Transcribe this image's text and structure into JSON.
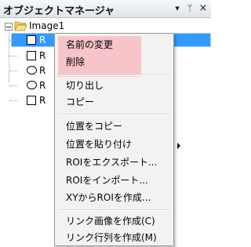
{
  "window": {
    "title": "オブジェクトマネージャ",
    "menu_glyph": "▾",
    "pin_glyph": "ᛘ",
    "close_glyph": "×"
  },
  "tree": {
    "root_label": "Image1",
    "children": [
      {
        "shape": "rectangle",
        "label": "R",
        "selected": true
      },
      {
        "shape": "rectangle",
        "label": "R",
        "selected": false
      },
      {
        "shape": "ellipse",
        "label": "R",
        "selected": false
      },
      {
        "shape": "ellipse",
        "label": "R",
        "selected": false
      },
      {
        "shape": "rectangle",
        "label": "R",
        "selected": false
      }
    ]
  },
  "context_menu": {
    "highlight_color": "#f7c4c9",
    "items": {
      "rename": "名前の変更",
      "delete": "削除",
      "cut": "切り出し",
      "copy": "コピー",
      "copy_position": "位置をコピー",
      "paste_position": "位置を貼り付け",
      "export_roi": "ROIをエクスポート...",
      "import_roi": "ROIをインポート...",
      "create_roi_from_xy": "XYからROIを作成...",
      "create_link_image": "リンク画像を作成(C)",
      "create_link_matrix": "リンク行列を作成(M)"
    }
  }
}
